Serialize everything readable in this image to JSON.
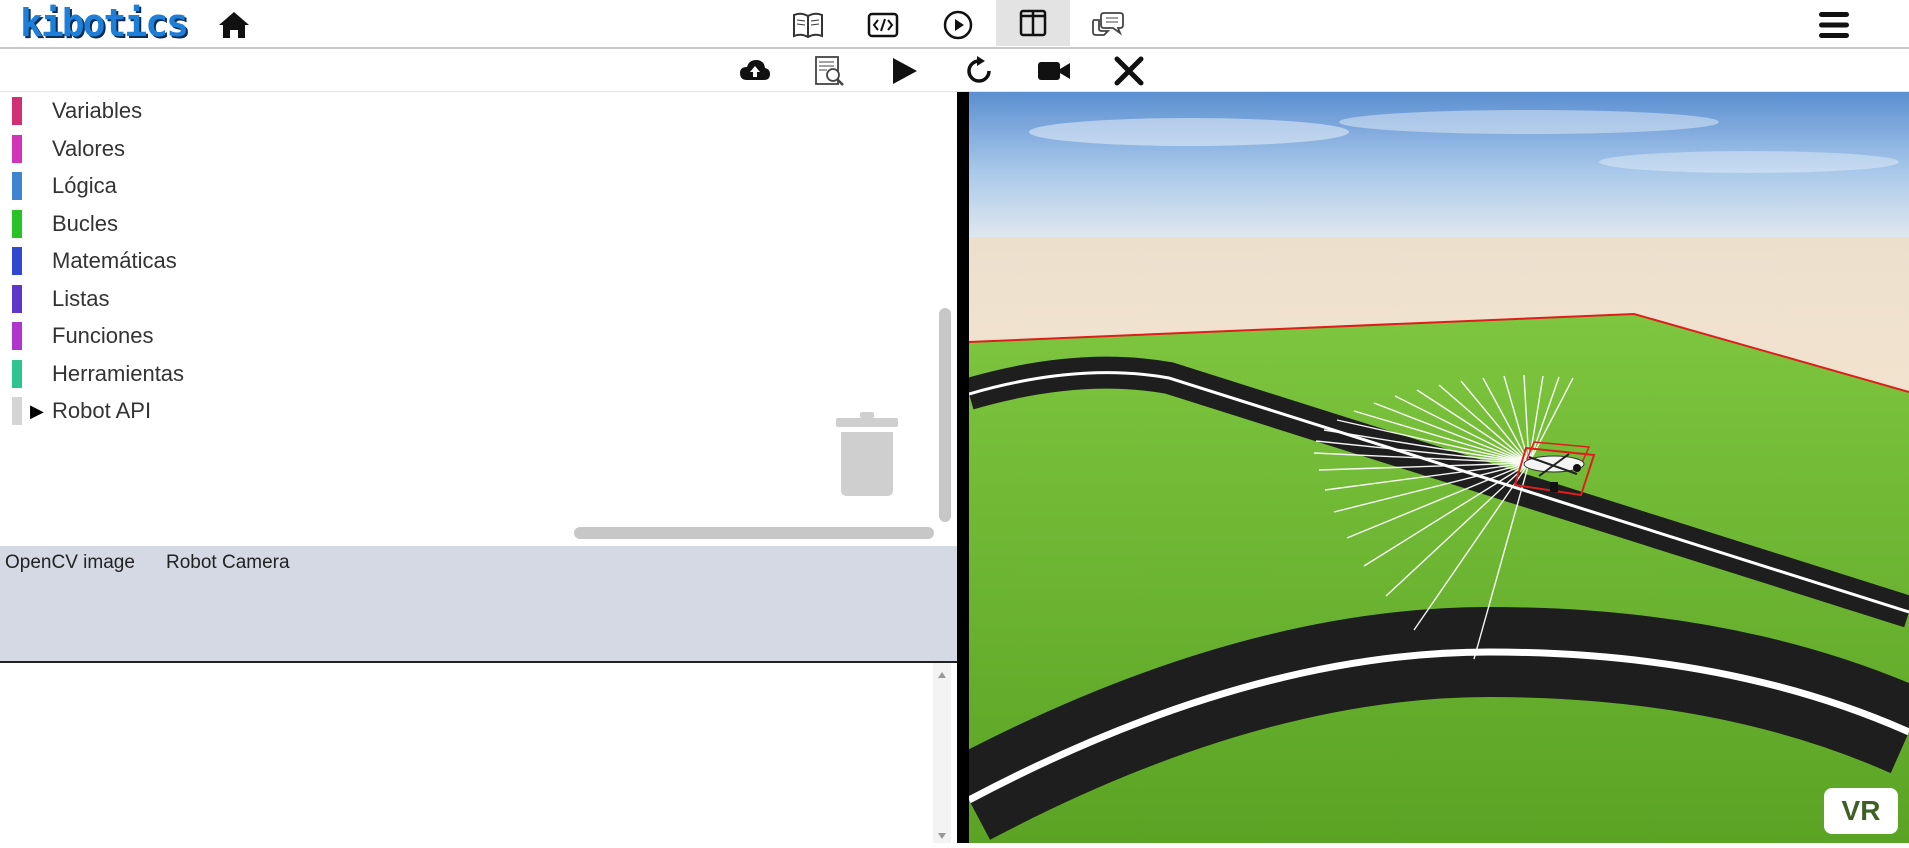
{
  "header": {
    "logo_text": "kibotics",
    "icons": [
      "home-icon",
      "book-icon",
      "code-icon",
      "play-circle-icon",
      "split-layout-icon",
      "chat-icon",
      "hamburger-menu-icon"
    ]
  },
  "toolbar": {
    "icons": [
      "cloud-upload-icon",
      "code-inspect-icon",
      "play-icon",
      "reload-icon",
      "video-camera-icon",
      "close-icon"
    ]
  },
  "categories": [
    {
      "label": "Variables",
      "color": "#d12e73"
    },
    {
      "label": "Valores",
      "color": "#d234b9"
    },
    {
      "label": "Lógica",
      "color": "#3f84d0"
    },
    {
      "label": "Bucles",
      "color": "#26c226"
    },
    {
      "label": "Matemáticas",
      "color": "#2e49cf"
    },
    {
      "label": "Listas",
      "color": "#5e36c9"
    },
    {
      "label": "Funciones",
      "color": "#b035cf"
    },
    {
      "label": "Herramientas",
      "color": "#2fc38f"
    },
    {
      "label": "Robot API",
      "color": "#d5d5d5"
    }
  ],
  "opencv": {
    "tabs": [
      "OpenCV image",
      "Robot Camera"
    ]
  },
  "viewport": {
    "vr_label": "VR"
  }
}
